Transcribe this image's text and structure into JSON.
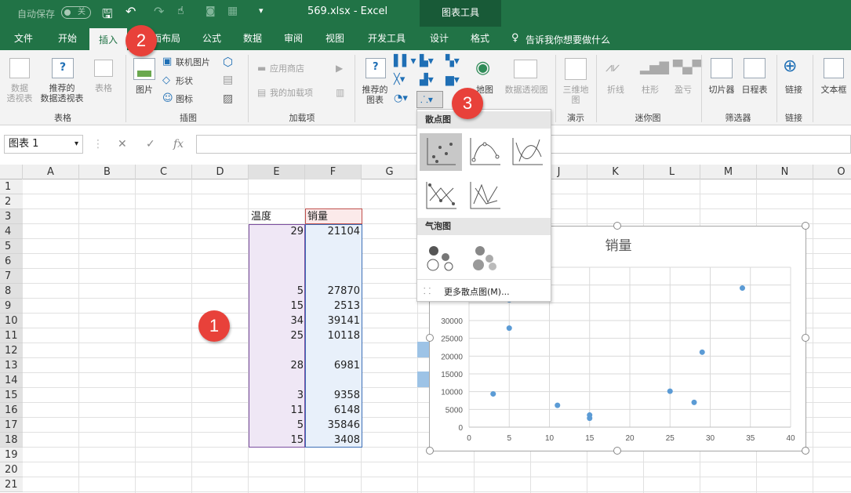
{
  "titlebar": {
    "autosave": "自动保存",
    "autosave_state": "关",
    "filename": "569.xlsx  -  Excel",
    "context_title": "图表工具"
  },
  "tabs": [
    "文件",
    "开始",
    "插入",
    "页面布局",
    "公式",
    "数据",
    "审阅",
    "视图",
    "开发工具",
    "设计",
    "格式"
  ],
  "tellme": "告诉我你想要做什么",
  "ribbon": {
    "pivot": "数据\n透视表",
    "recpivot": "推荐的\n数据透视表",
    "table": "表格",
    "group_tables": "表格",
    "picture": "图片",
    "online_pic": "联机图片",
    "shapes": "形状",
    "icons": "图标",
    "group_illus": "插图",
    "store": "应用商店",
    "myaddins": "我的加载项",
    "group_addins": "加载项",
    "recchart": "推荐的\n图表",
    "map": "地图",
    "pivotchart": "数据透视图",
    "map3d": "三维地\n图",
    "group_tour": "演示",
    "line": "折线",
    "column": "柱形",
    "winloss": "盈亏",
    "group_spark": "迷你图",
    "slicer": "切片器",
    "timeline": "日程表",
    "group_filter": "筛选器",
    "link": "链接",
    "group_link": "链接",
    "textbox": "文本框"
  },
  "formula": {
    "namebox": "图表 1",
    "fx": "fx"
  },
  "columns": [
    "A",
    "B",
    "C",
    "D",
    "E",
    "F",
    "G",
    "H",
    "I",
    "J",
    "K",
    "L",
    "M",
    "N",
    "O"
  ],
  "rows": [
    "1",
    "2",
    "3",
    "4",
    "5",
    "6",
    "7",
    "8",
    "9",
    "10",
    "11",
    "12",
    "13",
    "14",
    "15",
    "16",
    "17",
    "18",
    "19",
    "20",
    "21"
  ],
  "headers": {
    "e3": "温度",
    "f3": "销量"
  },
  "cells": [
    {
      "row": "4",
      "e": "29",
      "f": "21104"
    },
    {
      "row": "8",
      "e": "5",
      "f": "27870"
    },
    {
      "row": "9",
      "e": "15",
      "f": "2513"
    },
    {
      "row": "10",
      "e": "34",
      "f": "39141"
    },
    {
      "row": "11",
      "e": "25",
      "f": "10118"
    },
    {
      "row": "13",
      "e": "28",
      "f": "6981"
    },
    {
      "row": "15",
      "e": "3",
      "f": "9358"
    },
    {
      "row": "16",
      "e": "11",
      "f": "6148"
    },
    {
      "row": "17",
      "e": "5",
      "f": "35846"
    },
    {
      "row": "18",
      "e": "15",
      "f": "3408"
    }
  ],
  "dropdown": {
    "scatter_head": "散点图",
    "bubble_head": "气泡图",
    "more": "更多散点图(M)..."
  },
  "badges": [
    "1",
    "2",
    "3"
  ],
  "chart_data": {
    "type": "scatter",
    "title": "销量",
    "x": [
      29,
      5,
      15,
      34,
      25,
      28,
      3,
      11,
      5,
      15
    ],
    "y": [
      21104,
      27870,
      2513,
      39141,
      10118,
      6981,
      9358,
      6148,
      35846,
      3408
    ],
    "xlim": [
      0,
      40
    ],
    "ylim": [
      0,
      45000
    ],
    "xticks": [
      "0",
      "5",
      "10",
      "15",
      "20",
      "25",
      "30",
      "35",
      "40"
    ],
    "yticks": [
      "0",
      "5000",
      "10000",
      "15000",
      "20000",
      "25000",
      "30000"
    ],
    "color": "#5b9bd5",
    "grid": "on"
  },
  "colors": {
    "excel_green": "#217346",
    "badge": "#e8413a",
    "point": "#5b9bd5"
  }
}
